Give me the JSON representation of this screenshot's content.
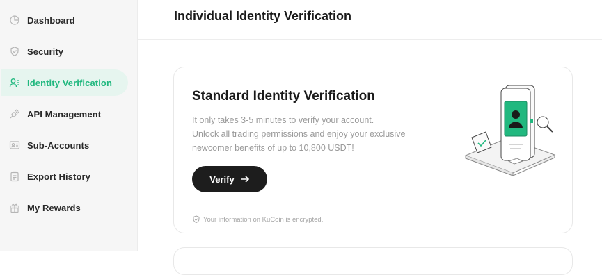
{
  "sidebar": {
    "items": [
      {
        "label": "Dashboard",
        "icon": "pie-chart-icon",
        "active": false
      },
      {
        "label": "Security",
        "icon": "shield-icon",
        "active": false
      },
      {
        "label": "Identity Verification",
        "icon": "user-id-icon",
        "active": true
      },
      {
        "label": "API Management",
        "icon": "api-plug-icon",
        "active": false
      },
      {
        "label": "Sub-Accounts",
        "icon": "sub-accounts-icon",
        "active": false
      },
      {
        "label": "Export History",
        "icon": "clipboard-icon",
        "active": false
      },
      {
        "label": "My Rewards",
        "icon": "gift-icon",
        "active": false
      }
    ]
  },
  "header": {
    "title": "Individual Identity Verification"
  },
  "card": {
    "title": "Standard Identity Verification",
    "desc_line1": "It only takes 3-5 minutes to verify your account.",
    "desc_line2": "Unlock all trading permissions and enjoy your exclusive newcomer benefits of up to 10,800 USDT!",
    "button_label": "Verify",
    "footnote": "Your information on KuCoin is encrypted."
  },
  "colors": {
    "accent": "#21b87f",
    "active_bg": "#e6f5ef",
    "button": "#1d1d1d"
  }
}
